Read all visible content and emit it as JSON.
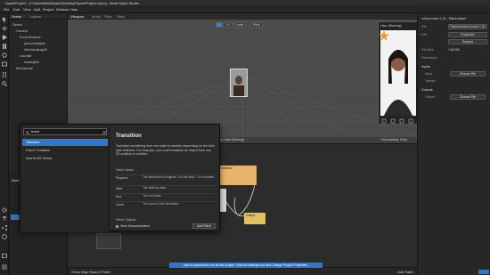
{
  "window": {
    "title": "SparkProject - C:\\Users\\MetaSpark\\Desktop\\SparkProject.arproj - Meta Spark Studio"
  },
  "menu": [
    "File",
    "Edit",
    "View",
    "Add",
    "Project",
    "Window",
    "Help"
  ],
  "scene": {
    "tabs": [
      "Scene",
      "Layers"
    ],
    "tree": [
      "Device",
      "Camera",
      "Focal Distance",
      "personsMight0",
      "directionalLight0",
      "canvas0",
      "rectangle0",
      "Microphone"
    ]
  },
  "assets": {
    "title": "Assets"
  },
  "viewport": {
    "tabs": [
      "Viewport",
      "Mode",
      "Filter",
      "View"
    ],
    "buttons": [
      "1",
      "1:1",
      "Local",
      "Pivot"
    ],
    "preview_label": "User (Starring)",
    "status_left": "Camera (Front) | User (Starring)",
    "status_right": "Grid spacing: 10cm"
  },
  "patch": {
    "nodes": [
      {
        "name": "Transition",
        "color": "#e7b46a"
      },
      {
        "name": "Display",
        "color": "#d7d7d7"
      },
      {
        "name": "Output",
        "color": "#e0c060"
      }
    ],
    "footer": {
      "left": "Show Map",
      "mid": "Search Patch",
      "right": "Add Patch"
    },
    "notification": "Add an experience cue for this project. Click the settings icon and Change Project Properties."
  },
  "search": {
    "query": "transi",
    "results": [
      "Transition",
      "Frame Transition",
      "Search AR Library"
    ],
    "selected": "Transition",
    "detail": {
      "title": "Transition",
      "description": "Transition something from one state to another depending on the time type selected. For example, you could transition an object from one 3D position to another.",
      "inputs_label": "Patch Inputs",
      "inputs": [
        {
          "name": "Progress",
          "desc": "The animation's progress. 0 is the start, 1 is complete."
        },
        {
          "name": "Start",
          "desc": "The starting state."
        },
        {
          "name": "End",
          "desc": "The end state."
        },
        {
          "name": "Curve",
          "desc": "The curve of the animation."
        }
      ],
      "outputs_label": "Patch Outputs",
      "docs_link": "View Documentation",
      "add_button": "Add Patch"
    }
  },
  "inspector": {
    "title": "colour invert 1.01 - Patch Asset",
    "rows": [
      {
        "label": "File",
        "value": "Patches/colour invert 1.01"
      },
      {
        "label": "Edit",
        "value": "Properties"
      },
      {
        "label": "",
        "value": "Replace"
      },
      {
        "label": "File Size",
        "value": "7.63 KB"
      }
    ],
    "description_label": "Description",
    "inputs_label": "Inputs",
    "inputs": [
      {
        "label": "Input",
        "value": "Choose File"
      },
      {
        "label": "Texture",
        "value": ""
      }
    ],
    "outputs_label": "Outputs",
    "outputs": [
      {
        "label": "Output",
        "value": "Choose File"
      }
    ]
  }
}
